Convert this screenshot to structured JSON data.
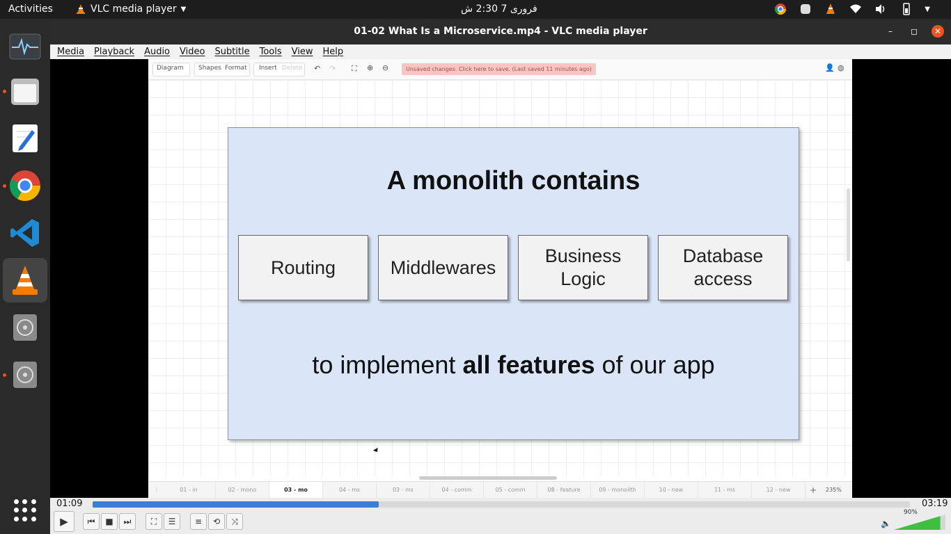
{
  "topbar": {
    "activities": "Activities",
    "app_name": "VLC media player",
    "clock": "فروری 7  2:30 ش"
  },
  "window": {
    "title": "01-02 What Is a Microservice.mp4 - VLC media player"
  },
  "menu": {
    "items": [
      "Media",
      "Playback",
      "Audio",
      "Video",
      "Subtitle",
      "Tools",
      "View",
      "Help"
    ]
  },
  "editor_toolbar": {
    "diagram": "Diagram",
    "shapes": "Shapes",
    "format": "Format",
    "insert": "Insert",
    "delete": "Delete",
    "unsaved": "Unsaved changes. Click here to save. (Last saved 11 minutes ago)"
  },
  "slide": {
    "headline": "A monolith contains",
    "blocks": [
      "Routing",
      "Middlewares",
      "Business Logic",
      "Database access"
    ],
    "tagline_pre": "to implement ",
    "tagline_bold": "all features",
    "tagline_post": " of our app"
  },
  "page_tabs": {
    "tabs": [
      "01 - in",
      "02 - mono",
      "03 - mo",
      "04 - ms",
      "03 - ms",
      "04 - comm",
      "05 - comm",
      "08 - feature",
      "09 - monolith",
      "10 - new",
      "11 - ms",
      "12 - new"
    ],
    "active_index": 2,
    "zoom": "235%"
  },
  "player": {
    "elapsed": "01:09",
    "total": "03:19",
    "progress_fraction": 0.35,
    "volume": "90%",
    "volume_fraction": 0.9
  },
  "colors": {
    "accent": "#e95420",
    "seek_fill": "#3b7dd8",
    "slide_bg": "#dae6f8",
    "volume_fill": "#3fbf3f"
  }
}
